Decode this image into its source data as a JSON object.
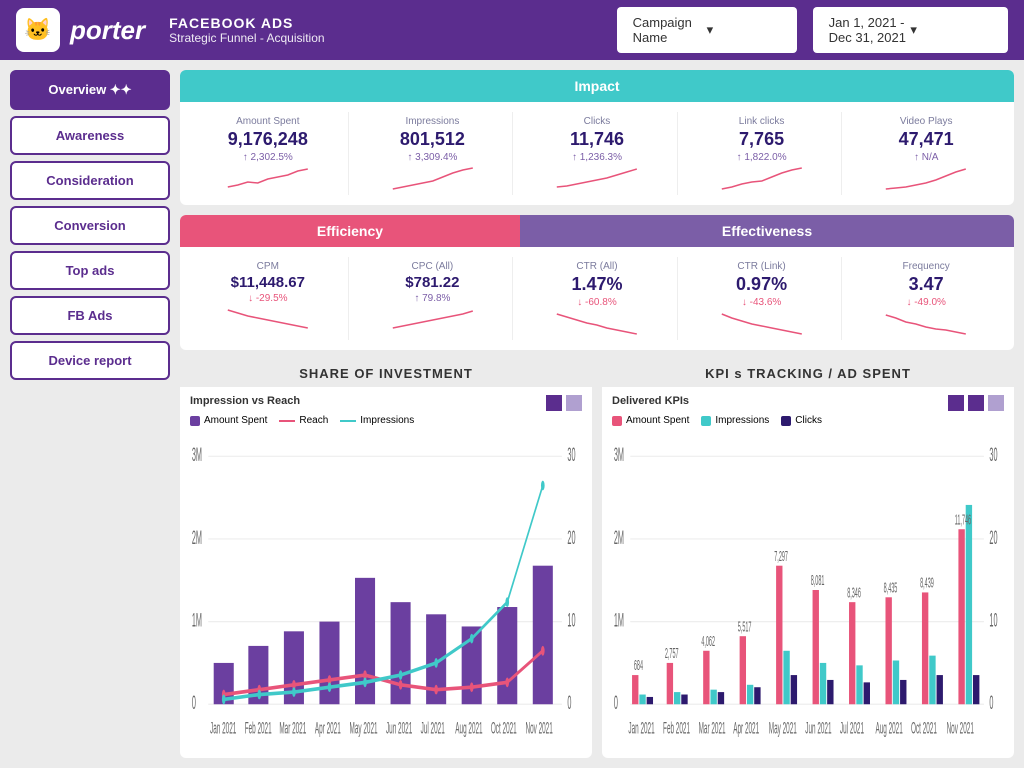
{
  "header": {
    "logo_emoji": "🐱",
    "logo_text": "porter",
    "title_line1": "FACEBOOK ADS",
    "title_line2": "Strategic Funnel - Acquisition",
    "campaign_label": "Campaign Name",
    "campaign_dropdown_char": "-",
    "date_range": "Jan 1, 2021 - Dec 31, 2021",
    "date_dropdown_char": "-"
  },
  "sidebar": {
    "items": [
      {
        "label": "Overview ✦✦",
        "active": true
      },
      {
        "label": "Awareness",
        "active": false
      },
      {
        "label": "Consideration",
        "active": false
      },
      {
        "label": "Conversion",
        "active": false
      },
      {
        "label": "Top ads",
        "active": false
      },
      {
        "label": "FB Ads",
        "active": false
      },
      {
        "label": "Device report",
        "active": false
      }
    ]
  },
  "impact": {
    "header": "Impact",
    "metrics": [
      {
        "label": "Amount Spent",
        "value": "9,176,248",
        "change": "↑ 2,302.5%",
        "direction": "up"
      },
      {
        "label": "Impressions",
        "value": "801,512",
        "change": "↑ 3,309.4%",
        "direction": "up"
      },
      {
        "label": "Clicks",
        "value": "11,746",
        "change": "↑ 1,236.3%",
        "direction": "up"
      },
      {
        "label": "Link clicks",
        "value": "7,765",
        "change": "↑ 1,822.0%",
        "direction": "up"
      },
      {
        "label": "Video Plays",
        "value": "47,471",
        "change": "↑ N/A",
        "direction": "up"
      }
    ]
  },
  "efficiency": {
    "header": "Efficiency",
    "metrics": [
      {
        "label": "CPM",
        "value": "$11,448.67",
        "change": "↓ -29.5%",
        "direction": "down"
      },
      {
        "label": "CPC (All)",
        "value": "$781.22",
        "change": "↑ 79.8%",
        "direction": "up"
      }
    ]
  },
  "effectiveness": {
    "header": "Effectiveness",
    "metrics": [
      {
        "label": "CTR (All)",
        "value": "1.47%",
        "change": "↓ -60.8%",
        "direction": "down"
      },
      {
        "label": "CTR (Link)",
        "value": "0.97%",
        "change": "↓ -43.6%",
        "direction": "down"
      },
      {
        "label": "Frequency",
        "value": "3.47",
        "change": "↓ -49.0%",
        "direction": "down"
      }
    ]
  },
  "share_of_investment": {
    "title": "SHARE OF INVESTMENT",
    "subtitle": "Impression vs Reach",
    "legend": [
      {
        "label": "Amount Spent",
        "type": "bar",
        "color": "#6b3fa0"
      },
      {
        "label": "Reach",
        "type": "line",
        "color": "#e8547a"
      },
      {
        "label": "Impressions",
        "type": "line",
        "color": "#40c9c9"
      }
    ],
    "months": [
      "Jan 2021",
      "Feb 2021",
      "Mar 2021",
      "Apr 2021",
      "May 2021",
      "Jun 2021",
      "Jul 2021",
      "Aug 2021",
      "Oct 2021",
      "Nov 2021"
    ],
    "y_labels": [
      "3M",
      "2M",
      "1M",
      "0"
    ],
    "y2_labels": [
      "30",
      "20",
      "10",
      "0"
    ]
  },
  "kpi_tracking": {
    "title": "KPI s TRACKING / AD SPENT",
    "subtitle": "Delivered KPIs",
    "legend": [
      {
        "label": "Amount Spent",
        "type": "bar",
        "color": "#e8547a"
      },
      {
        "label": "Impressions",
        "type": "bar",
        "color": "#40c9c9"
      },
      {
        "label": "Clicks",
        "type": "bar",
        "color": "#2d1a6e"
      }
    ],
    "values": [
      "684",
      "2,757",
      "4,062",
      "5,517",
      "7,297",
      "8,081",
      "8,346",
      "8,435",
      "8,439",
      "11,746"
    ],
    "months": [
      "Jan 2021",
      "Feb 2021",
      "Mar 2021",
      "Apr 2021",
      "May 2021",
      "Jun 2021",
      "Jul 2021",
      "Aug 2021",
      "Oct 2021",
      "Nov 2021"
    ],
    "y_labels": [
      "3M",
      "2M",
      "1M",
      "0"
    ],
    "y2_labels": [
      "30",
      "20",
      "10",
      "0"
    ]
  }
}
